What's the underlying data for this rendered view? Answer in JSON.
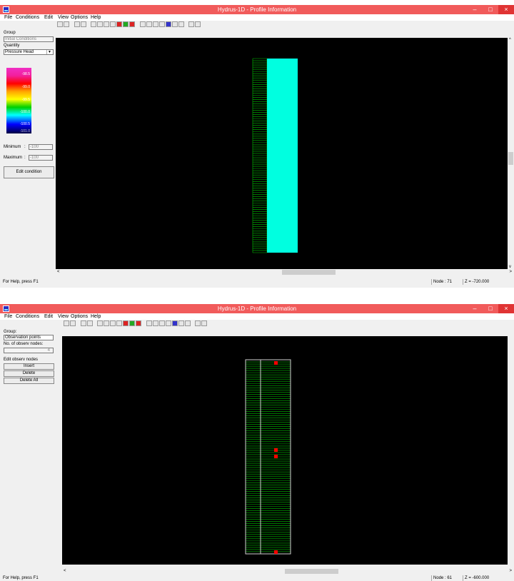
{
  "window_title": "Hydrus-1D - Profile Information",
  "window_controls": {
    "minimize": "–",
    "maximize": "□",
    "close": "×"
  },
  "menu": [
    "File",
    "Conditions",
    "Edit",
    "View",
    "Options",
    "Help"
  ],
  "windows": [
    {
      "left_panel": {
        "group_label": "Group",
        "group_value": "Initial Conditions",
        "quantity_label": "Quantity",
        "quantity_value": "Pressure Head",
        "legend_values": [
          "-98.5",
          "-99.0",
          "-99.5",
          "-100.0",
          "-100.5",
          "-101.0"
        ],
        "minimum_label": "Minimum",
        "minimum_sep": ":",
        "minimum_value": "-100",
        "maximum_label": "Maximum",
        "maximum_sep": ":",
        "maximum_value": "-100",
        "edit_button": "Edit condition"
      },
      "status": {
        "help": "For Help, press F1",
        "node": "Node : 71",
        "z": "Z = -720.000"
      },
      "scroll": {
        "left_arrow": "<",
        "right_arrow": ">",
        "up_arrow": "^",
        "down_arrow": "v"
      }
    },
    {
      "left_panel": {
        "group_label": "Group:",
        "group_value": "Observation points",
        "count_label": "No. of observ nodes:",
        "count_value": "4",
        "edit_label": "Edit observ nodes",
        "buttons": [
          "Insert",
          "Delete",
          "Delete All"
        ]
      },
      "status": {
        "help": "For Help, press F1",
        "node": "Node : 61",
        "z": "Z = -600.000"
      },
      "scroll": {
        "left_arrow": "<",
        "right_arrow": ">"
      }
    }
  ],
  "colors": {
    "title_bar": "#f15b5b",
    "canvas": "#000000",
    "profile_fill": "#00ffe0",
    "mesh": "#00c000",
    "observation_point": "#ff0000"
  },
  "icons": [
    "app-icon",
    "print-icon",
    "save-icon",
    "grid-icon",
    "zoom-icon",
    "help-icon",
    "whats-this-icon"
  ]
}
